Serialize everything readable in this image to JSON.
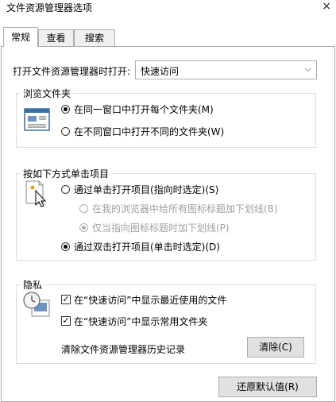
{
  "window": {
    "title": "文件资源管理器选项",
    "close_glyph": "×"
  },
  "tabs": [
    {
      "label": "常规",
      "active": true
    },
    {
      "label": "查看",
      "active": false
    },
    {
      "label": "搜索",
      "active": false
    }
  ],
  "open_in": {
    "label": "打开文件资源管理器时打开:",
    "value": "快速访问",
    "arrow": "⌵"
  },
  "browse_folders": {
    "title": "浏览文件夹",
    "options": [
      {
        "label": "在同一窗口中打开每个文件夹(M)",
        "checked": true
      },
      {
        "label": "在不同窗口中打开不同的文件夹(W)",
        "checked": false
      }
    ]
  },
  "click_items": {
    "title": "按如下方式单击项目",
    "single_click": {
      "label": "通过单击打开项目(指向时选定)(S)",
      "checked": false
    },
    "underline_browser": {
      "label": "在我的浏览器中给所有图标标题加下划线(B)",
      "checked": false
    },
    "underline_hover": {
      "label": "仅当指向图标标题时加下划线(P)",
      "checked": true
    },
    "double_click": {
      "label": "通过双击打开项目(单击时选定)(D)",
      "checked": true
    }
  },
  "privacy": {
    "title": "隐私",
    "show_recent": {
      "label": "在“快速访问”中显示最近使用的文件",
      "check_glyph": "✓"
    },
    "show_frequent": {
      "label": "在“快速访问”中显示常用文件夹",
      "check_glyph": "✓"
    },
    "clear_label": "清除文件资源管理器历史记录",
    "clear_button": "清除(C)"
  },
  "restore_defaults": "还原默认值(R)",
  "colors": {
    "accent": "#0078d7",
    "border": "#adadad",
    "disabled": "#a0a0a0"
  }
}
